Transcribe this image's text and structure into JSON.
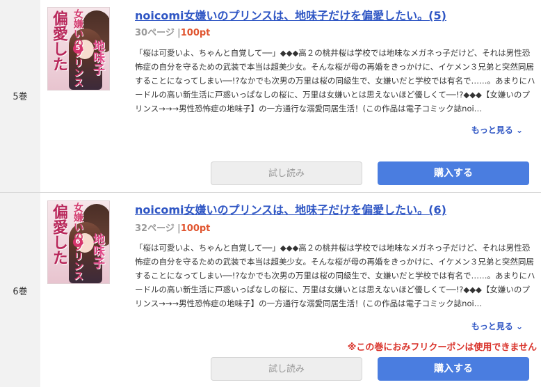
{
  "volumes": [
    {
      "vol_label": "5巻",
      "cover": {
        "series_big": "偏愛した",
        "series_mid": "女嫌いのプリンス",
        "series_pink": "地味子",
        "badge": "5"
      },
      "title": "noicomi女嫌いのプリンスは、地味子だけを偏愛したい。(5)",
      "pages": "30ページ",
      "separator": "|",
      "price": "100pt",
      "description": "「桜は可愛いよ、ちゃんと自覚して──」◆◆◆高２の桃井桜は学校では地味なメガネっ子だけど、それは男性恐怖症の自分を守るための武装で本当は超美少女。そんな桜が母の再婚をきっかけに、イケメン３兄弟と突然同居することになってしまい──!?なかでも次男の万里は桜の同級生で、女嫌いだと学校では有名で……。あまりにハードルの高い新生活に戸惑いっぱなしの桜に、万里は女嫌いとは思えないほど優しくて──!?◆◆◆【女嫌いのプリンス→→→男性恐怖症の地味子】の一方通行な溺愛同居生活！(この作品は電子コミック誌noi…",
      "more_label": "もっと見る",
      "more_arrow": "⌄",
      "trial_label": "試し読み",
      "buy_label": "購入する"
    },
    {
      "vol_label": "6巻",
      "cover": {
        "series_big": "偏愛した",
        "series_mid": "女嫌いのプリンス",
        "series_pink": "地味子",
        "badge": "6"
      },
      "title": "noicomi女嫌いのプリンスは、地味子だけを偏愛したい。(6)",
      "pages": "32ページ",
      "separator": "|",
      "price": "100pt",
      "description": "「桜は可愛いよ、ちゃんと自覚して──」◆◆◆高２の桃井桜は学校では地味なメガネっ子だけど、それは男性恐怖症の自分を守るための武装で本当は超美少女。そんな桜が母の再婚をきっかけに、イケメン３兄弟と突然同居することになってしまい──!?なかでも次男の万里は桜の同級生で、女嫌いだと学校では有名で……。あまりにハードルの高い新生活に戸惑いっぱなしの桜に、万里は女嫌いとは思えないほど優しくて──!?◆◆◆【女嫌いのプリンス→→→男性恐怖症の地味子】の一方通行な溺愛同居生活！(この作品は電子コミック誌noi…",
      "more_label": "もっと見る",
      "more_arrow": "⌄",
      "notice": "※この巻におみフリクーポンは使用できません",
      "trial_label": "試し読み",
      "buy_label": "購入する"
    }
  ],
  "colors": {
    "title_link": "#2f56c4",
    "price": "#e0542e",
    "buy_button": "#4a7de0",
    "notice": "#d9322a"
  }
}
